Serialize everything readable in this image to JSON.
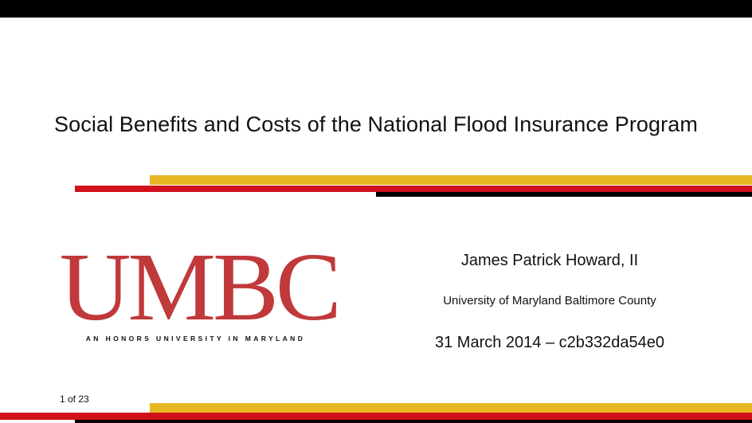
{
  "slide": {
    "title": "Social Benefits and Costs of the National Flood Insurance Program",
    "author": "James Patrick Howard, II",
    "institution": "University of Maryland Baltimore County",
    "date": "31 March 2014 – c2b332da54e0",
    "page_number": "1 of 23"
  },
  "logo": {
    "wordmark": "UMBC",
    "tagline": "AN HONORS UNIVERSITY IN MARYLAND"
  },
  "colors": {
    "black": "#000000",
    "red": "#d0111b",
    "gold": "#e8b824",
    "logo_red": "#c0393b"
  }
}
